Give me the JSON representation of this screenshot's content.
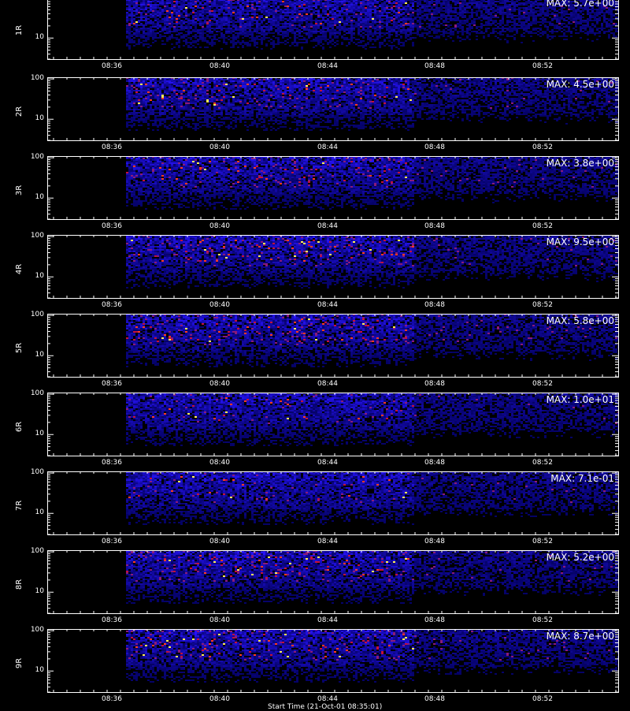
{
  "chart_data": {
    "type": "heatmap",
    "time_ticks": [
      "08:36",
      "08:40",
      "08:44",
      "08:48",
      "08:52"
    ],
    "y_ticks": [
      "100",
      "10"
    ],
    "ylog": true,
    "yrange": [
      3,
      110
    ],
    "panels": [
      {
        "label": "1R",
        "max_text": "MAX: 5.7e+00",
        "intensity": 0.45
      },
      {
        "label": "2R",
        "max_text": "MAX: 4.5e+00",
        "intensity": 0.55
      },
      {
        "label": "3R",
        "max_text": "MAX: 3.8e+00",
        "intensity": 0.55
      },
      {
        "label": "4R",
        "max_text": "MAX: 9.5e+00",
        "intensity": 0.7
      },
      {
        "label": "5R",
        "max_text": "MAX: 5.8e+00",
        "intensity": 0.85
      },
      {
        "label": "6R",
        "max_text": "MAX: 1.0e+01",
        "intensity": 0.3
      },
      {
        "label": "7R",
        "max_text": "MAX: 7.1e-01",
        "intensity": 0.3
      },
      {
        "label": "8R",
        "max_text": "MAX: 5.2e+00",
        "intensity": 0.6
      },
      {
        "label": "9R",
        "max_text": "MAX: 8.7e+00",
        "intensity": 0.7
      }
    ]
  },
  "footer": "Start Time (21-Oct-01 08:35:01)"
}
